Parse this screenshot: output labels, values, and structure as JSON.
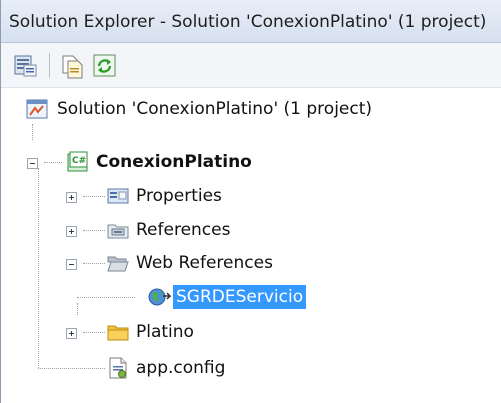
{
  "window": {
    "title": "Solution Explorer - Solution 'ConexionPlatino' (1 project)"
  },
  "toolbar": {
    "buttons": [
      {
        "name": "properties-icon"
      },
      {
        "name": "show-all-files-icon"
      },
      {
        "name": "refresh-icon"
      }
    ]
  },
  "tree": {
    "solution_label": "Solution 'ConexionPlatino' (1 project)",
    "project_label": "ConexionPlatino",
    "properties_label": "Properties",
    "references_label": "References",
    "web_references_label": "Web References",
    "service_label": "SGRDEServicio",
    "platino_label": "Platino",
    "config_label": "app.config"
  },
  "colors": {
    "selection": "#3399ff",
    "folder": "#f5c33b",
    "csharp_project": "#2f8f3a"
  }
}
